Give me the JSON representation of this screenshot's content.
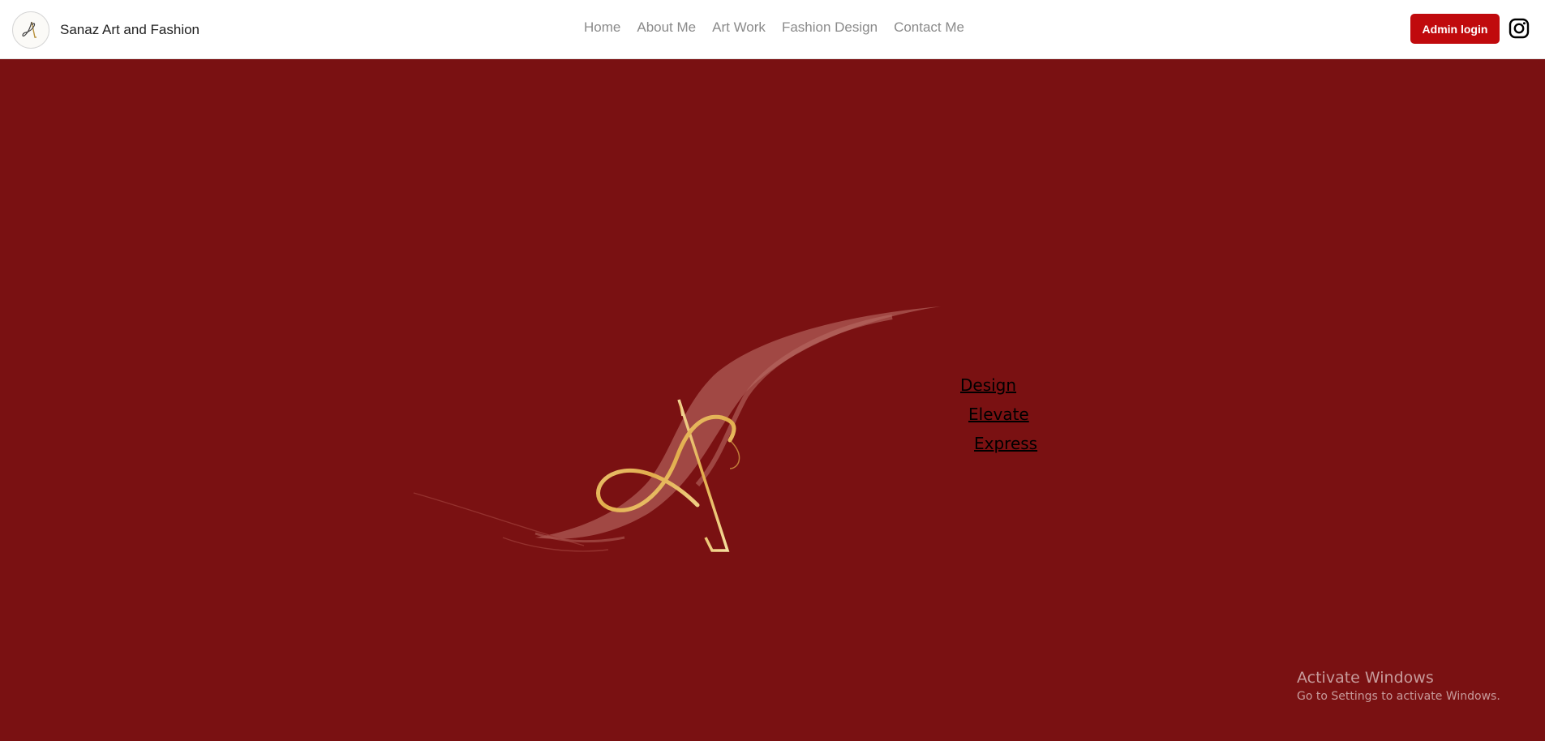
{
  "header": {
    "brand_name": "Sanaz Art and Fashion",
    "nav": [
      "Home",
      "About Me",
      "Art Work",
      "Fashion Design",
      "Contact Me"
    ],
    "admin_label": "Admin login",
    "social_icon": "instagram-icon"
  },
  "hero": {
    "logo_icon": "script-a-monogram-icon",
    "taglines": [
      "Design",
      "Elevate",
      "Express"
    ]
  },
  "watermark": {
    "title": "Activate Windows",
    "subtitle": "Go to Settings to activate Windows."
  },
  "colors": {
    "navbar_bg": "#ffffff",
    "hero_bg": "#7a1112",
    "button_bg": "#c00a0d",
    "brush": "#a8524d",
    "gold": "#e5b95a"
  }
}
